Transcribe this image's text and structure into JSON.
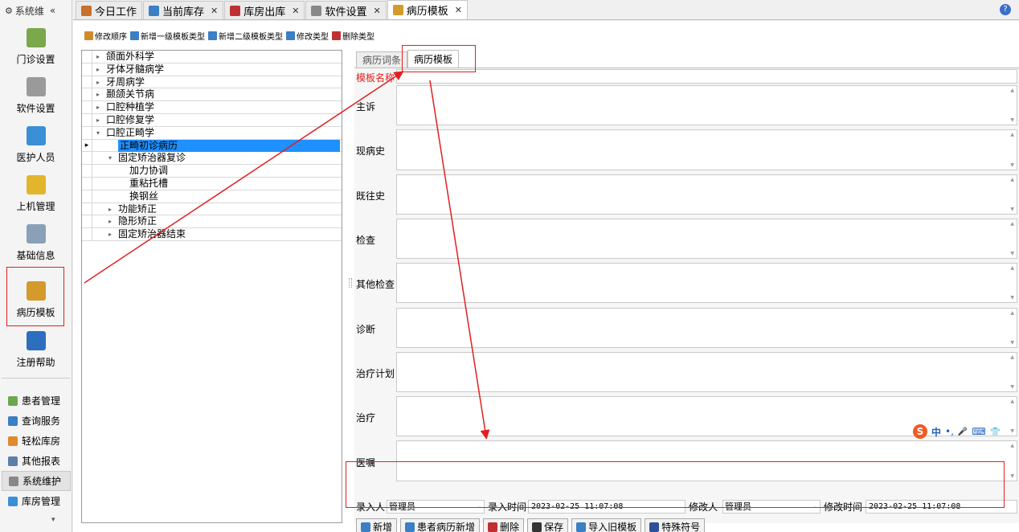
{
  "sidebar": {
    "header": "系统维",
    "collapse": "«",
    "big_items": [
      {
        "label": "门诊设置",
        "icon": "house-icon",
        "color": "#7aa84a"
      },
      {
        "label": "软件设置",
        "icon": "gears-icon",
        "color": "#9a9a9a"
      },
      {
        "label": "医护人员",
        "icon": "users-icon",
        "color": "#3b8fd6"
      },
      {
        "label": "上机管理",
        "icon": "lock-icon",
        "color": "#e3b52c"
      },
      {
        "label": "基础信息",
        "icon": "settings-doc-icon",
        "color": "#8aa0b8"
      },
      {
        "label": "病历模板",
        "icon": "tree-template-icon",
        "color": "#d49a2c"
      },
      {
        "label": "注册帮助",
        "icon": "help-book-icon",
        "color": "#2c6fbf"
      }
    ],
    "small_items": [
      {
        "label": "患者管理",
        "icon": "patients-icon",
        "color": "#6aa84f"
      },
      {
        "label": "查询服务",
        "icon": "search-window-icon",
        "color": "#3b7fc4"
      },
      {
        "label": "轻松库房",
        "icon": "warehouse-icon",
        "color": "#e08a2c"
      },
      {
        "label": "其他报表",
        "icon": "report-icon",
        "color": "#5b7fa8"
      },
      {
        "label": "系统维护",
        "icon": "tools-icon",
        "color": "#888888"
      },
      {
        "label": "库房管理",
        "icon": "inventory-icon",
        "color": "#3b8fd6"
      }
    ],
    "more": "▾"
  },
  "tabs": [
    {
      "label": "今日工作",
      "icon": "work-icon",
      "color": "#c8702c",
      "closable": false
    },
    {
      "label": "当前库存",
      "icon": "table-icon",
      "color": "#3b7fc4",
      "closable": true
    },
    {
      "label": "库房出库",
      "icon": "outbound-icon",
      "color": "#c03030",
      "closable": true
    },
    {
      "label": "软件设置",
      "icon": "gears-icon",
      "color": "#888888",
      "closable": true
    },
    {
      "label": "病历模板",
      "icon": "tree-template-icon",
      "color": "#d49a2c",
      "closable": true
    }
  ],
  "close_mark": "✕",
  "help": "?",
  "toolbar": [
    {
      "label": "修改顺序",
      "icon": "sort-icon",
      "color": "#d08a2c"
    },
    {
      "label": "新增一级模板类型",
      "icon": "add-tree-icon",
      "color": "#3b7fc4"
    },
    {
      "label": "新增二级模板类型",
      "icon": "add-subtree-icon",
      "color": "#3b7fc4"
    },
    {
      "label": "修改类型",
      "icon": "edit-type-icon",
      "color": "#3b7fc4"
    },
    {
      "label": "删除类型",
      "icon": "delete-type-icon",
      "color": "#c03030"
    }
  ],
  "tree": [
    {
      "label": "颌面外科学",
      "level": 0,
      "toggle": "▸"
    },
    {
      "label": "牙体牙髓病学",
      "level": 0,
      "toggle": "▸"
    },
    {
      "label": "牙周病学",
      "level": 0,
      "toggle": "▸"
    },
    {
      "label": "颞颌关节病",
      "level": 0,
      "toggle": "▸"
    },
    {
      "label": "口腔种植学",
      "level": 0,
      "toggle": "▸"
    },
    {
      "label": "口腔修复学",
      "level": 0,
      "toggle": "▸"
    },
    {
      "label": "口腔正畸学",
      "level": 0,
      "toggle": "▾"
    },
    {
      "label": "正畸初诊病历",
      "level": 1,
      "toggle": "",
      "selected": true
    },
    {
      "label": "固定矫治器复诊",
      "level": 1,
      "toggle": "▾"
    },
    {
      "label": "加力协调",
      "level": 2,
      "toggle": ""
    },
    {
      "label": "重粘托槽",
      "level": 2,
      "toggle": ""
    },
    {
      "label": "换钢丝",
      "level": 2,
      "toggle": ""
    },
    {
      "label": "功能矫正",
      "level": 1,
      "toggle": "▸"
    },
    {
      "label": "隐形矫正",
      "level": 1,
      "toggle": "▸"
    },
    {
      "label": "固定矫治器结束",
      "level": 1,
      "toggle": "▸"
    }
  ],
  "row_pointer": "▸",
  "right_tabs": [
    "病历词条",
    "病历模板"
  ],
  "form": {
    "name_label": "模板名称",
    "name_value": "",
    "fields": [
      "主诉",
      "现病史",
      "既往史",
      "检查",
      "其他检查",
      "诊断",
      "治疗计划",
      "治疗",
      "医嘱"
    ]
  },
  "meta": {
    "creator_label": "录入人",
    "creator": "管理员",
    "ctime_label": "录入时间",
    "ctime": "2023-02-25 11:07:08",
    "modifier_label": "修改人",
    "modifier": "管理员",
    "mtime_label": "修改时间",
    "mtime": "2023-02-25 11:07:08",
    "dropdown_mark": "⌄"
  },
  "buttons": [
    {
      "label": "新增",
      "icon": "add-icon",
      "color": "#3b7fc4"
    },
    {
      "label": "患者病历新增",
      "icon": "patient-add-icon",
      "color": "#3b7fc4"
    },
    {
      "label": "删除",
      "icon": "delete-icon",
      "color": "#c03030"
    },
    {
      "label": "保存",
      "icon": "save-icon",
      "color": "#333333"
    },
    {
      "label": "导入旧模板",
      "icon": "import-icon",
      "color": "#3b7fc4"
    },
    {
      "label": "特殊符号",
      "icon": "symbol-icon",
      "color": "#2c4f9a"
    }
  ],
  "ime": {
    "logo": "S",
    "lang": "中",
    "punct": "•,",
    "mic": "🎤",
    "keyboard": "⌨",
    "skin": "👕"
  },
  "colors": {
    "annotation_red": "#e02020",
    "selection": "#1e90ff",
    "required_label": "#e02020"
  }
}
